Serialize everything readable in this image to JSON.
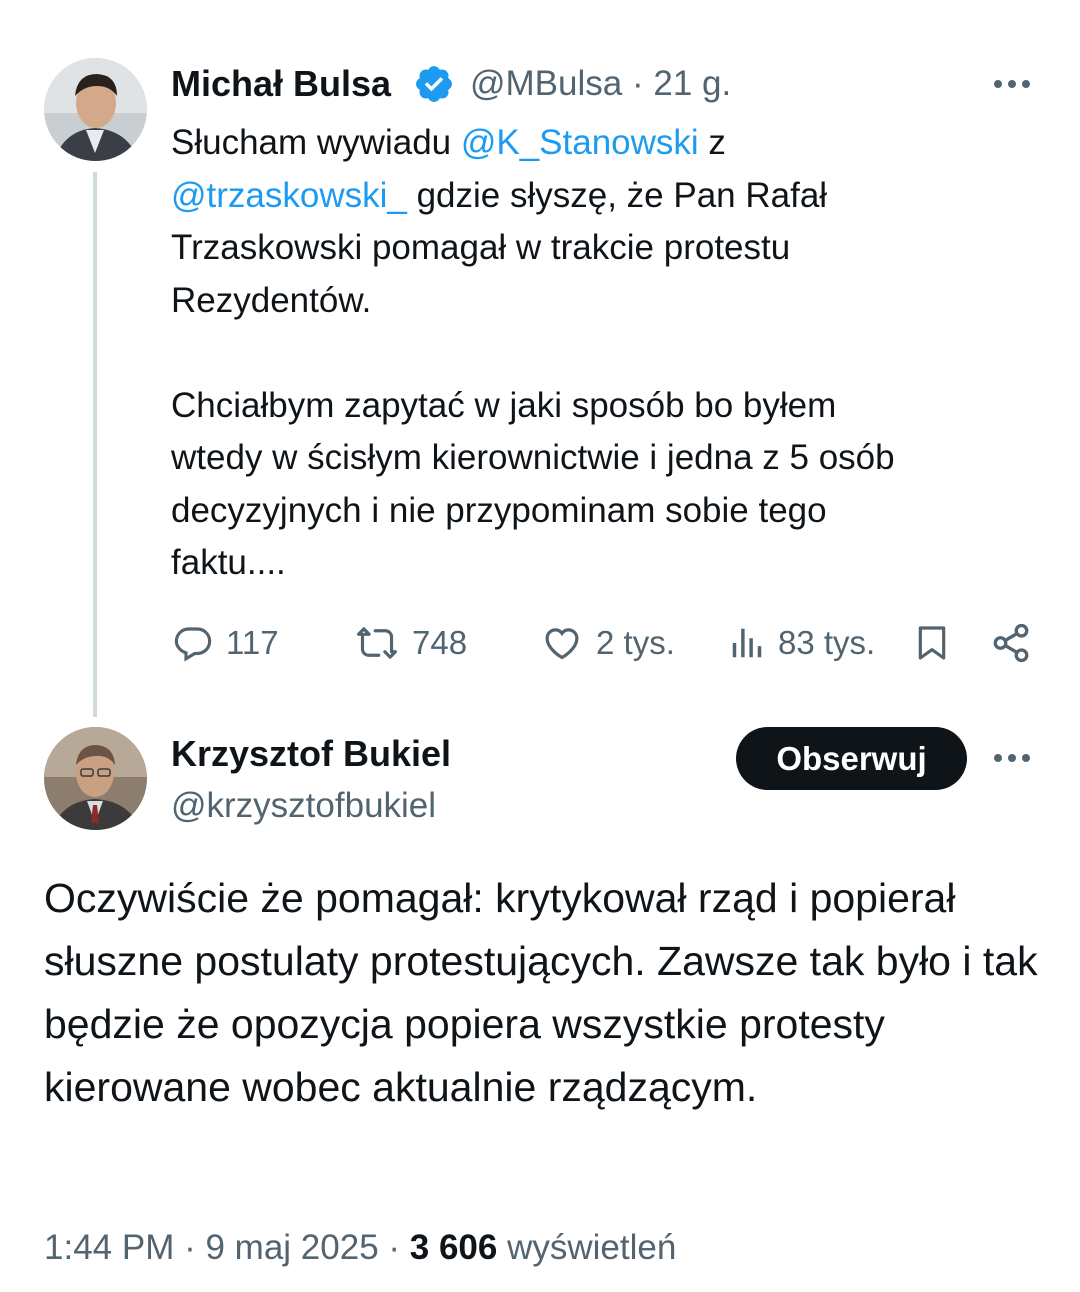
{
  "tweet1": {
    "author_name": "Michał Bulsa",
    "handle": "@MBulsa",
    "separator": "·",
    "time": "21 g.",
    "text_parts": [
      {
        "text": "Słucham wywiadu ",
        "mention": false
      },
      {
        "text": "@K_Stanowski",
        "mention": true
      },
      {
        "text": " z\n",
        "mention": false
      },
      {
        "text": "@trzaskowski_",
        "mention": true
      },
      {
        "text": " gdzie słyszę, że Pan Rafał\nTrzaskowski pomagał w trakcie protestu\nRezydentów.\n\nChciałbym zapytać w jaki sposób bo byłem\nwtedy w ścisłym kierownictwie i jedna z 5 osób\ndecyzyjnych i nie przypominam sobie tego\nfaktu....",
        "mention": false
      }
    ],
    "replies": "117",
    "reposts": "748",
    "likes": "2 tys.",
    "views": "83 tys.",
    "icons": [
      "verified-icon",
      "more-icon",
      "reply-icon",
      "repost-icon",
      "like-icon",
      "views-icon",
      "bookmark-icon",
      "share-icon"
    ]
  },
  "tweet2": {
    "author_name": "Krzysztof Bukiel",
    "handle": "@krzysztofbukiel",
    "follow_label": "Obserwuj",
    "text": "Oczywiście że pomagał: krytykował rząd i popierał słuszne postulaty protestujących. Zawsze tak było i tak będzie że opozycja popiera wszystkie protesty kierowane wobec aktualnie rządzącym.",
    "time": "1:44 PM",
    "date": "9 maj 2025",
    "separator": "·",
    "views_count": "3 606",
    "views_label": "wyświetleń"
  },
  "colors": {
    "accent": "#1d9bf0",
    "text": "#0f1419",
    "secondary": "#536471",
    "thread_line": "#cfd9de",
    "button_bg": "#0f1419"
  }
}
